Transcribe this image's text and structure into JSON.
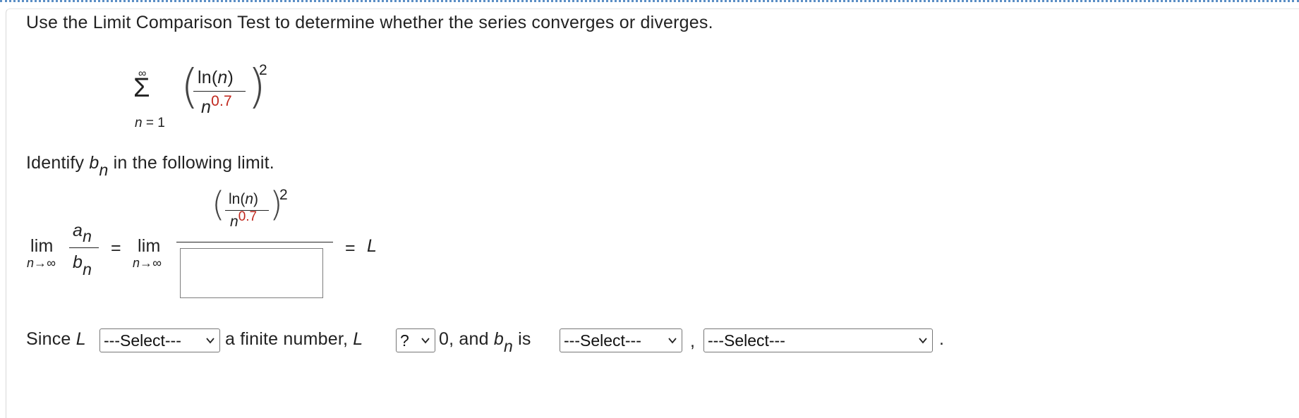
{
  "question": {
    "prompt": "Use the Limit Comparison Test to determine whether the series converges or diverges."
  },
  "series": {
    "sum_symbol": "Σ",
    "upper_limit": "∞",
    "lower_limit": "n = 1",
    "numerator": "ln(",
    "numerator_var": "n",
    "numerator_close": ")",
    "denominator_base": "n",
    "denominator_exponent": "0.7",
    "outer_exponent": "2"
  },
  "identify": {
    "prefix": "Identify ",
    "b": "b",
    "n": "n",
    "suffix": " in the following limit."
  },
  "limit": {
    "lim_word": "lim",
    "lim_under": "n→∞",
    "a": "a",
    "a_sub": "n",
    "b": "b",
    "b_sub": "n",
    "equals1": "=",
    "lim_word2": "lim",
    "lim_under2": "n→∞",
    "numer_numerator": "ln(",
    "numer_var": "n",
    "numer_close": ")",
    "numer_den_base": "n",
    "numer_den_exp": "0.7",
    "numer_outer_exp": "2",
    "answer_value": "",
    "equals2": "=",
    "result": "L"
  },
  "conclusion": {
    "since": "Since ",
    "L1": "L",
    "select1": "---Select---",
    "middle": " a finite number, ",
    "L2": "L",
    "select2": "?",
    "after_select2": " 0, and ",
    "b": "b",
    "b_sub": "n",
    "is": " is",
    "select3": "---Select---",
    "comma": ",",
    "select4": "---Select---",
    "period": "."
  }
}
